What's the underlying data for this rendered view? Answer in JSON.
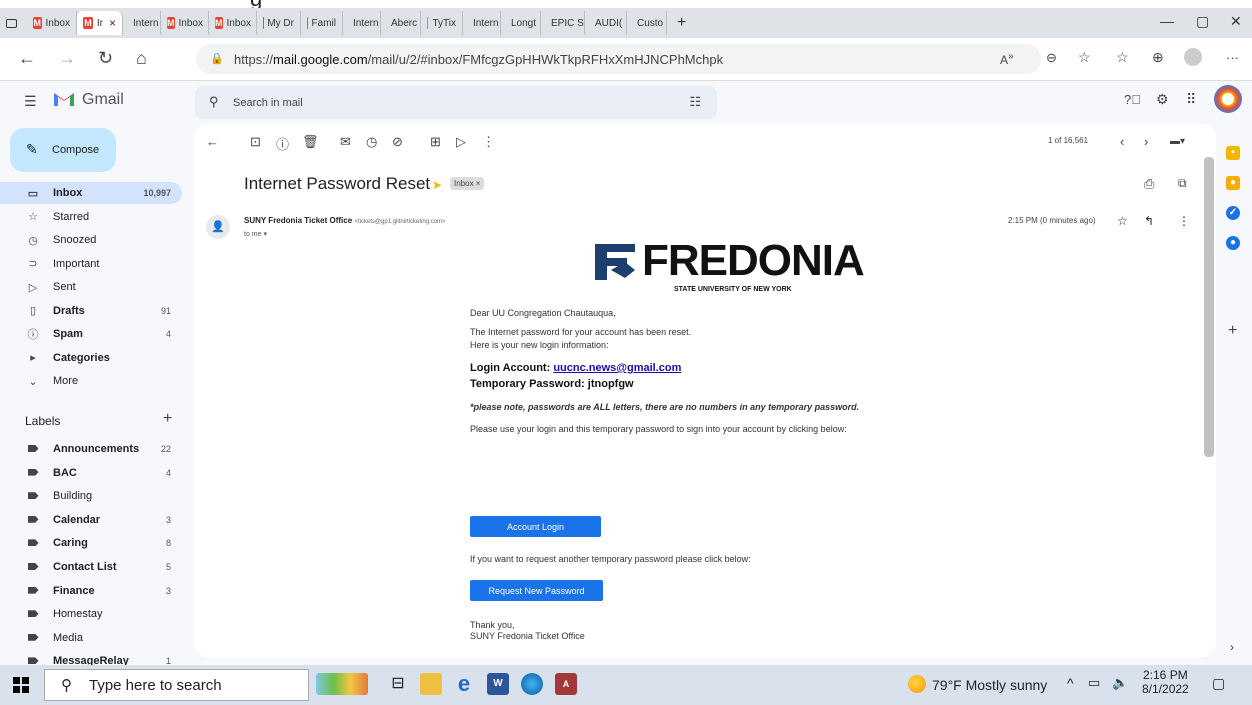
{
  "browser": {
    "tabs": [
      {
        "label": "Inbox",
        "icon": "gmail-icon"
      },
      {
        "label": "Ir",
        "icon": "gmail-icon",
        "active": true,
        "close": "×"
      },
      {
        "label": "Intern",
        "icon": "web-icon"
      },
      {
        "label": "Inbox",
        "icon": "gmail-icon"
      },
      {
        "label": "Inbox",
        "icon": "gmail-icon"
      },
      {
        "label": "My Dr",
        "icon": "drive-icon"
      },
      {
        "label": "Famil",
        "icon": "docs-icon"
      },
      {
        "label": "Intern",
        "icon": "web-icon"
      },
      {
        "label": "Aberc",
        "icon": "web-icon"
      },
      {
        "label": "TyTix",
        "icon": "page-icon"
      },
      {
        "label": "Intern",
        "icon": "web-icon"
      },
      {
        "label": "Longt",
        "icon": "web-icon"
      },
      {
        "label": "EPIC S",
        "icon": "web-icon"
      },
      {
        "label": "AUDI(",
        "icon": "drive-icon"
      },
      {
        "label": "Custo",
        "icon": "web-icon"
      }
    ],
    "new_tab": "+",
    "url_prefix": "https://",
    "url_host": "mail.google.com",
    "url_path": "/mail/u/2/#inbox/FMfcgzGpHHWkTkpRFHxXmHJNCPhMchpk"
  },
  "gmail": {
    "brand": "Gmail",
    "search_placeholder": "Search in mail",
    "compose": "Compose",
    "nav": [
      {
        "label": "Inbox",
        "count": "10,997",
        "icon": "inbox-icon",
        "active": true
      },
      {
        "label": "Starred",
        "count": "",
        "icon": "star-icon"
      },
      {
        "label": "Snoozed",
        "count": "",
        "icon": "clock-icon"
      },
      {
        "label": "Important",
        "count": "",
        "icon": "important-icon"
      },
      {
        "label": "Sent",
        "count": "",
        "icon": "send-icon"
      },
      {
        "label": "Drafts",
        "count": "91",
        "icon": "draft-icon",
        "bold": true
      },
      {
        "label": "Spam",
        "count": "4",
        "icon": "spam-icon",
        "bold": true
      },
      {
        "label": "Categories",
        "count": "",
        "icon": "label-icon",
        "bold": true
      },
      {
        "label": "More",
        "count": "",
        "icon": "chevron-down-icon"
      }
    ],
    "labels_title": "Labels",
    "labels": [
      {
        "label": "Announcements",
        "count": "22",
        "bold": true
      },
      {
        "label": "BAC",
        "count": "4",
        "bold": true
      },
      {
        "label": "Building",
        "count": ""
      },
      {
        "label": "Calendar",
        "count": "3",
        "bold": true
      },
      {
        "label": "Caring",
        "count": "8",
        "bold": true
      },
      {
        "label": "Contact List",
        "count": "5",
        "bold": true
      },
      {
        "label": "Finance",
        "count": "3",
        "bold": true
      },
      {
        "label": "Homestay",
        "count": ""
      },
      {
        "label": "Media",
        "count": ""
      },
      {
        "label": "MessageRelay",
        "count": "1",
        "bold": true
      }
    ],
    "pager": "1 of 16,561",
    "subject": "Internet Password Reset",
    "chip": "Inbox ×",
    "sender_name": "SUNY Fredonia Ticket Office",
    "sender_email": "<tickets@gp1.glitnirticketing.com>",
    "to": "to me ▾",
    "time": "2:15 PM (0 minutes ago)"
  },
  "email": {
    "logo_text": "FREDONIA",
    "logo_sub": "STATE UNIVERSITY OF NEW YORK",
    "greeting": "Dear UU Congregation Chautauqua,",
    "line1": "The Internet password for your account has been reset.",
    "line2": "Here is your new login information:",
    "login_label": "Login Account:",
    "login_value": "uucnc.news@gmail.com",
    "temp_label": "Temporary Password:",
    "temp_value": "jtnopfgw",
    "note": "*please note, passwords are ALL letters, there are no numbers in any temporary password.",
    "instruction": "Please use your login and this temporary password to sign into your account by clicking below:",
    "login_button": "Account Login",
    "request_text": "If you want to request another temporary password please click below:",
    "request_button": "Request New Password",
    "thanks": "Thank you,",
    "signoff": "SUNY Fredonia Ticket Office"
  },
  "taskbar": {
    "search_placeholder": "Type here to search",
    "weather": "79°F  Mostly sunny",
    "time": "2:16 PM",
    "date": "8/1/2022"
  },
  "colors": {
    "accent": "#1a73e8",
    "compose_bg": "#c2e7ff",
    "active_nav": "#d3e3fd",
    "logo": "#1c3f6e"
  }
}
